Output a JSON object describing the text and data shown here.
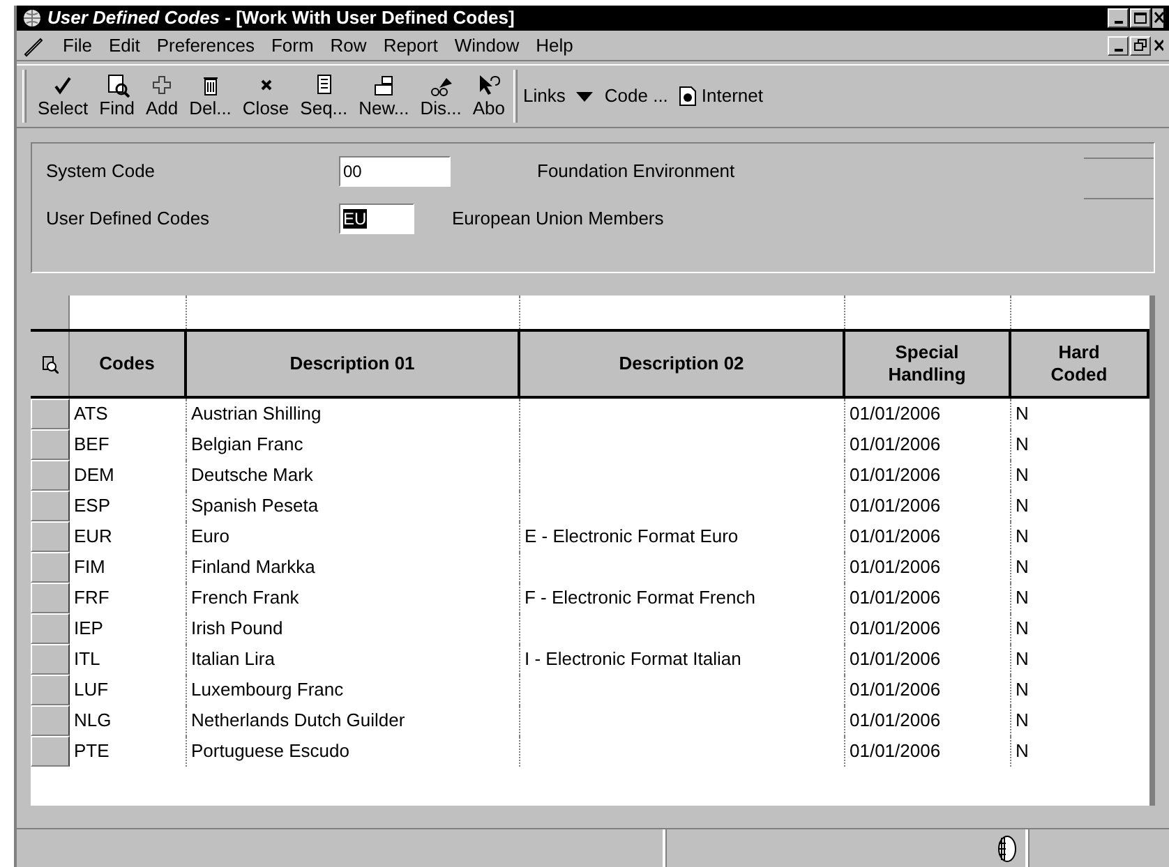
{
  "window": {
    "title_app": "User Defined Codes",
    "title_form": " - [Work With User Defined Codes]"
  },
  "menu": [
    "File",
    "Edit",
    "Preferences",
    "Form",
    "Row",
    "Report",
    "Window",
    "Help"
  ],
  "toolbar": [
    "Select",
    "Find",
    "Add",
    "Del...",
    "Close",
    "Seq...",
    "New...",
    "Dis...",
    "Abo"
  ],
  "links": [
    {
      "label": "Links",
      "kind": "caret"
    },
    {
      "label": "Code ...",
      "kind": "text"
    },
    {
      "label": "Internet",
      "kind": "page"
    }
  ],
  "fields": [
    {
      "label": "System Code",
      "value": "00",
      "description": "Foundation Environment",
      "text_selected": false
    },
    {
      "label": "User Defined Codes",
      "value": "EU",
      "description": "European Union Members",
      "text_selected": true
    }
  ],
  "table": {
    "columns": [
      "Codes",
      "Description 01",
      "Description 02",
      "Special Handling",
      "Hard Coded"
    ],
    "rows": [
      [
        "ATS",
        "Austrian Shilling",
        "",
        "01/01/2006",
        "N"
      ],
      [
        "BEF",
        "Belgian Franc",
        "",
        "01/01/2006",
        "N"
      ],
      [
        "DEM",
        "Deutsche Mark",
        "",
        "01/01/2006",
        "N"
      ],
      [
        "ESP",
        "Spanish Peseta",
        "",
        "01/01/2006",
        "N"
      ],
      [
        "EUR",
        "Euro",
        "E - Electronic Format Euro",
        "01/01/2006",
        "N"
      ],
      [
        "FIM",
        "Finland Markka",
        "",
        "01/01/2006",
        "N"
      ],
      [
        "FRF",
        "French Frank",
        "F - Electronic Format French",
        "01/01/2006",
        "N"
      ],
      [
        "IEP",
        "Irish Pound",
        "",
        "01/01/2006",
        "N"
      ],
      [
        "ITL",
        "Italian Lira",
        "I - Electronic Format Italian",
        "01/01/2006",
        "N"
      ],
      [
        "LUF",
        "Luxembourg Franc",
        "",
        "01/01/2006",
        "N"
      ],
      [
        "NLG",
        "Netherlands Dutch Guilder",
        "",
        "01/01/2006",
        "N"
      ],
      [
        "PTE",
        "Portuguese Escudo",
        "",
        "01/01/2006",
        "N"
      ]
    ]
  }
}
